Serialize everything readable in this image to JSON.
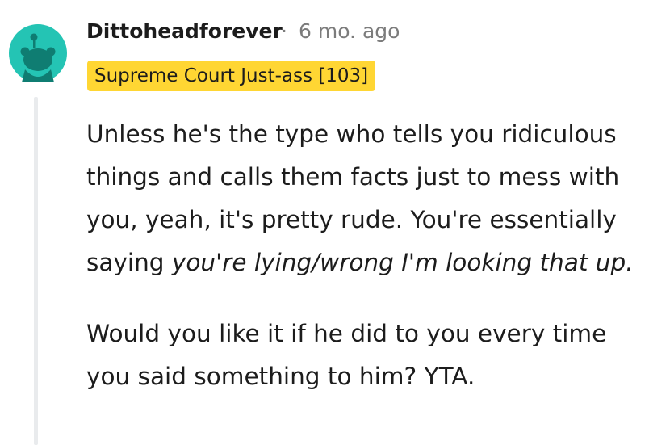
{
  "comment": {
    "author": "Dittoheadforever",
    "separator": "·",
    "timestamp": "6 mo. ago",
    "flair": "Supreme Court Just-ass [103]",
    "paragraphs": [
      {
        "text": "Unless he's the type who tells you ridiculous things and calls them facts just to mess with you, yeah, it's pretty rude. You're essentially saying ",
        "italic": "you're lying/wrong I'm looking that up."
      },
      {
        "text": "Would you like it if he did to you every time you said something to him? YTA."
      }
    ]
  },
  "colors": {
    "avatar_background": "#24c4b4",
    "avatar_figure": "#0f7d72",
    "flair_background": "#ffd633",
    "thread_line": "#e9ebed",
    "meta_text": "#7c7c7c",
    "body_text": "#1c1c1c"
  },
  "icons": {
    "avatar": "snoo-avatar-icon"
  }
}
